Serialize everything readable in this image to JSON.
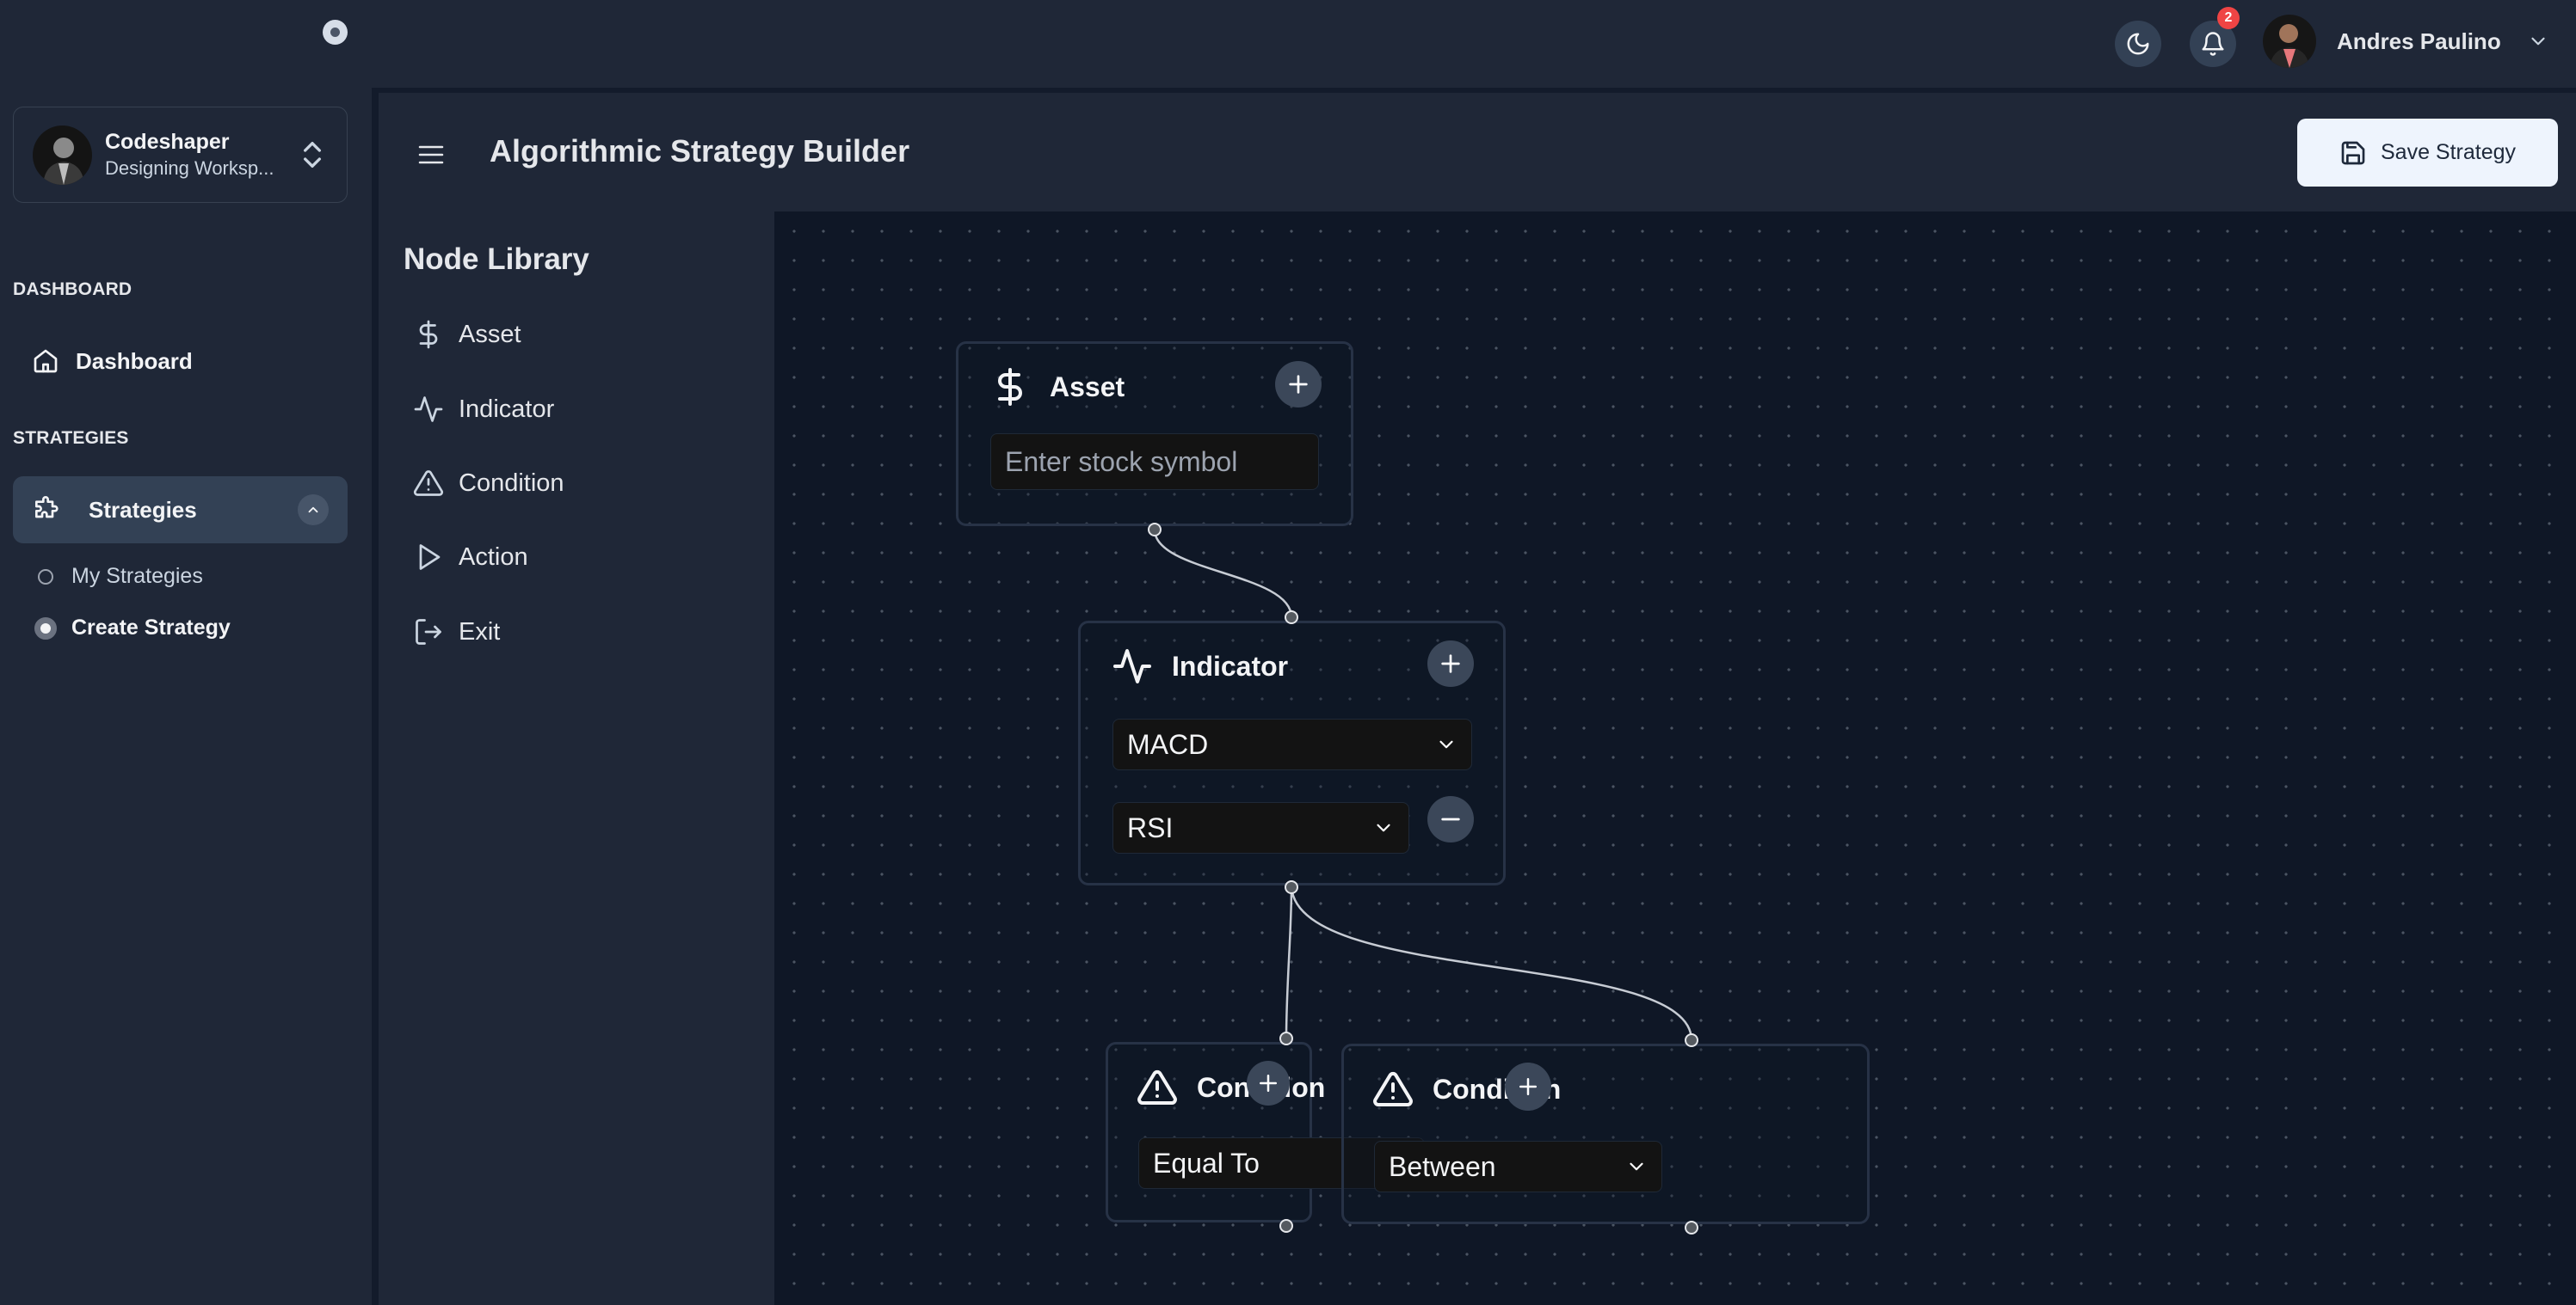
{
  "sidebar": {
    "workspace": {
      "name": "Codeshaper",
      "subtitle": "Designing Worksp..."
    },
    "sections": [
      {
        "label": "DASHBOARD"
      },
      {
        "label": "STRATEGIES"
      }
    ],
    "dashboard_item": {
      "label": "Dashboard",
      "icon": "home-icon"
    },
    "strategies_item": {
      "label": "Strategies",
      "icon": "puzzle-icon",
      "expanded": true
    },
    "sub_items": [
      {
        "label": "My Strategies",
        "active": false
      },
      {
        "label": "Create Strategy",
        "active": true
      }
    ]
  },
  "topbar": {
    "theme_icon": "moon-icon",
    "notification_icon": "bell-icon",
    "notification_count": "2",
    "user_name": "Andres Paulino"
  },
  "header": {
    "title": "Algorithmic Strategy Builder",
    "save_label": "Save Strategy"
  },
  "library": {
    "title": "Node Library",
    "items": [
      {
        "label": "Asset",
        "icon": "dollar-icon"
      },
      {
        "label": "Indicator",
        "icon": "activity-icon"
      },
      {
        "label": "Condition",
        "icon": "alert-triangle-icon"
      },
      {
        "label": "Action",
        "icon": "play-icon"
      },
      {
        "label": "Exit",
        "icon": "log-out-icon"
      }
    ]
  },
  "canvas": {
    "nodes": [
      {
        "id": "asset",
        "title": "Asset",
        "icon": "dollar-icon",
        "input_placeholder": "Enter stock symbol",
        "input_value": ""
      },
      {
        "id": "indicator",
        "title": "Indicator",
        "icon": "activity-icon",
        "selects": [
          "MACD",
          "RSI"
        ]
      },
      {
        "id": "condition-1",
        "title": "Condition",
        "icon": "alert-triangle-icon",
        "select": "Equal To"
      },
      {
        "id": "condition-2",
        "title": "Condition",
        "icon": "alert-triangle-icon",
        "select": "Between"
      }
    ],
    "edges": [
      {
        "from": "asset",
        "to": "indicator"
      },
      {
        "from": "indicator",
        "to": "condition-1"
      },
      {
        "from": "indicator",
        "to": "condition-2"
      }
    ]
  },
  "colors": {
    "sidebar_bg": "#1f2737",
    "canvas_bg": "#0f1726",
    "accent_button": "#eef4fd",
    "badge": "#ef4444"
  }
}
